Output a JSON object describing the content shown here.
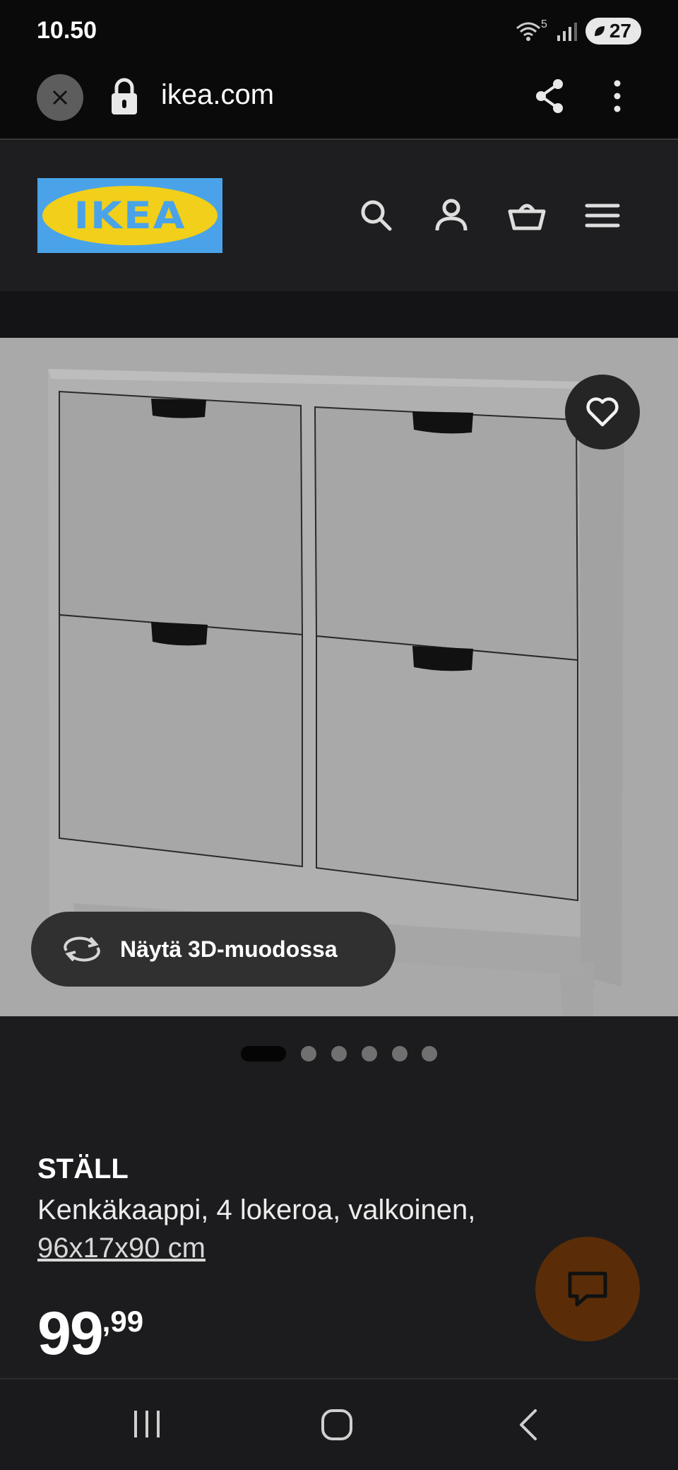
{
  "status_bar": {
    "time": "10.50",
    "network": "5",
    "battery": "27"
  },
  "browser": {
    "url": "ikea.com"
  },
  "header": {
    "logo_text": "IKEA",
    "logo_colors": {
      "blue": "#4aa3e8",
      "yellow": "#f1cf1a"
    }
  },
  "gallery": {
    "view_3d_label": "Näytä 3D-muodossa",
    "image_count": 6,
    "active_image": 1
  },
  "product": {
    "name": "STÄLL",
    "description": "Kenkäkaappi, 4 lokeroa, valkoinen,",
    "dimensions": "96x17x90 cm",
    "price_int": "99",
    "price_dec": ",99"
  },
  "icons": [
    "close-icon",
    "lock-icon",
    "share-icon",
    "more-icon",
    "search-icon",
    "user-icon",
    "basket-icon",
    "menu-icon",
    "heart-icon",
    "rotate-3d-icon",
    "chat-icon",
    "recents-icon",
    "home-icon",
    "back-icon"
  ],
  "colors": {
    "chat_button": "#5a2d08",
    "gallery_bg": "#a9a9a9"
  }
}
